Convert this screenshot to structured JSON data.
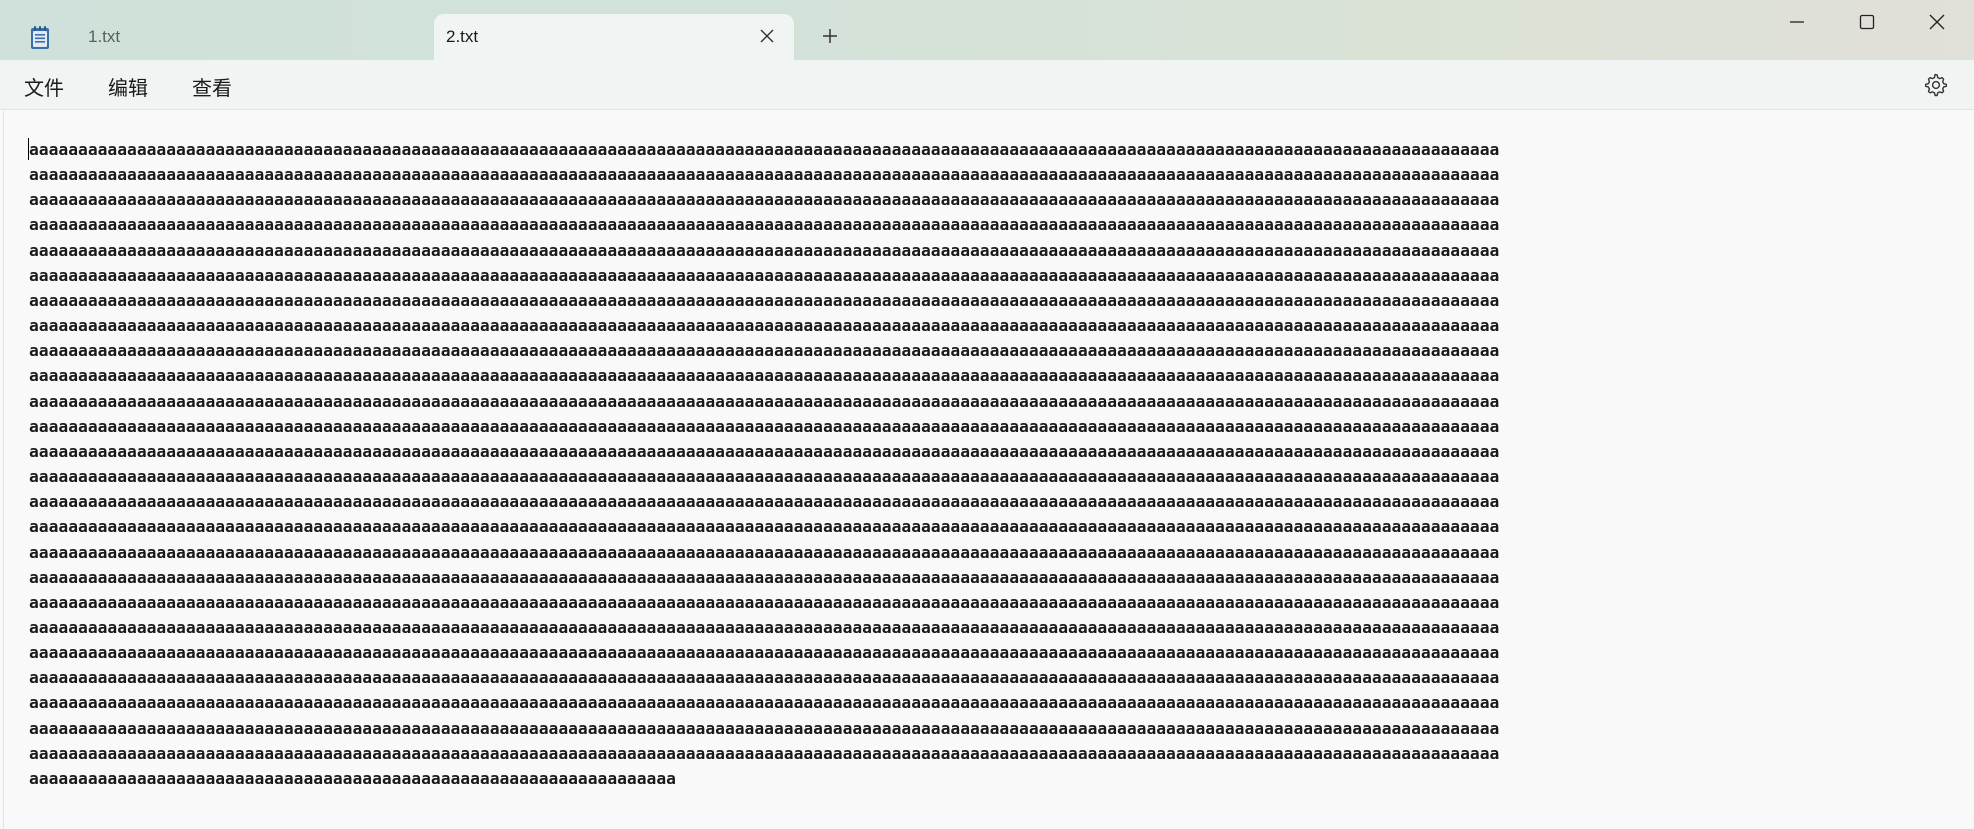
{
  "tabs": [
    {
      "label": "1.txt",
      "active": false
    },
    {
      "label": "2.txt",
      "active": true
    }
  ],
  "menu": {
    "file": "文件",
    "edit": "编辑",
    "view": "查看"
  },
  "icons": {
    "app": "notepad-icon",
    "close_tab": "close-icon",
    "new_tab": "plus-icon",
    "minimize": "minimize-icon",
    "maximize": "maximize-icon",
    "close_window": "close-icon",
    "settings": "gear-icon"
  },
  "editor": {
    "char": "a",
    "full_lines": 25,
    "chars_per_line": 150,
    "last_line_chars": 66
  }
}
